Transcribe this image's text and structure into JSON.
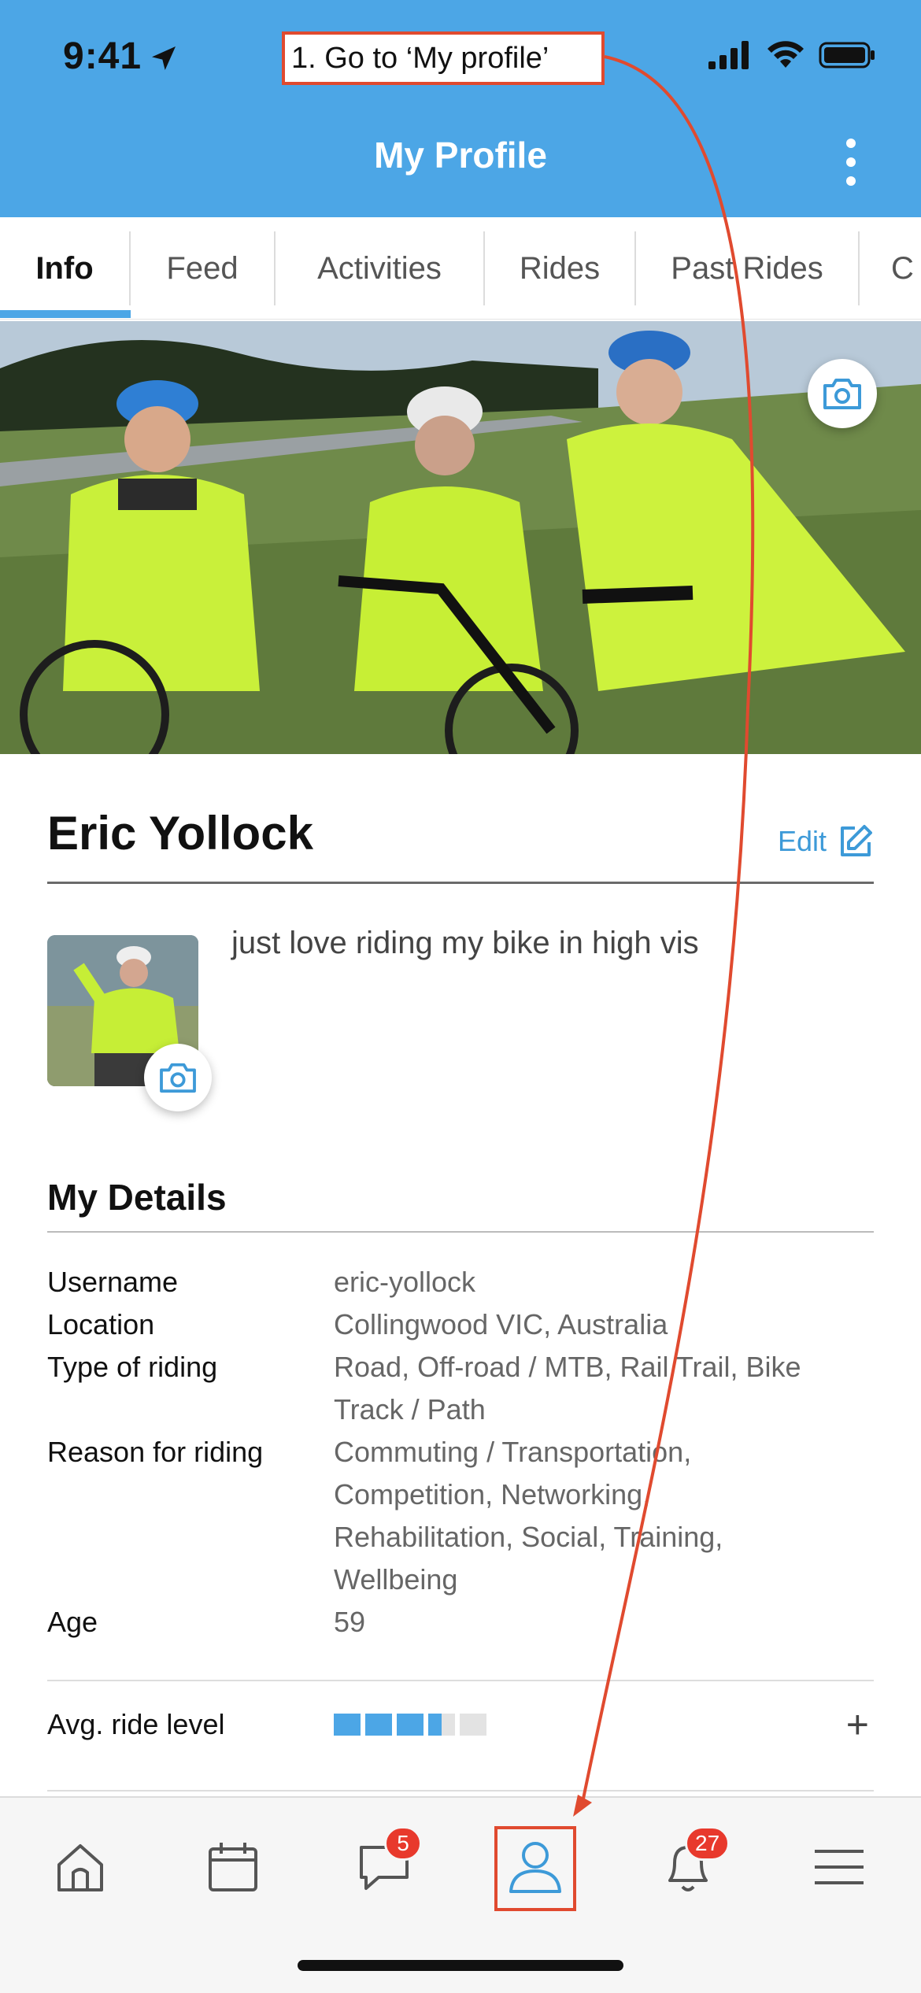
{
  "status_bar": {
    "time": "9:41"
  },
  "annotation": {
    "text": "1. Go to ‘My profile’",
    "color": "#e04a2f"
  },
  "header": {
    "title": "My Profile",
    "menu_icon": "kebab-menu-icon"
  },
  "tabs": [
    {
      "label": "Info",
      "active": true
    },
    {
      "label": "Feed",
      "active": false
    },
    {
      "label": "Activities",
      "active": false
    },
    {
      "label": "Rides",
      "active": false
    },
    {
      "label": "Past Rides",
      "active": false
    },
    {
      "label": "C",
      "active": false
    }
  ],
  "profile": {
    "name": "Eric Yollock",
    "edit_label": "Edit",
    "bio": "just love riding my bike in high vis"
  },
  "details": {
    "title": "My Details",
    "rows": [
      {
        "label": "Username",
        "value": "eric-yollock"
      },
      {
        "label": "Location",
        "value": "Collingwood VIC, Australia"
      },
      {
        "label": "Type of riding",
        "value": "Road, Off-road / MTB, Rail Trail, Bike Track / Path"
      },
      {
        "label": "Reason for riding",
        "value": "Commuting / Transportation, Competition, Networking, Rehabilitation, Social, Training, Wellbeing"
      },
      {
        "label": "Age",
        "value": "59"
      }
    ]
  },
  "ride_level": {
    "label": "Avg. ride level",
    "level": 3.5,
    "max": 5,
    "action": "+"
  },
  "bottom_nav": {
    "items": [
      {
        "name": "home",
        "icon": "home-icon"
      },
      {
        "name": "calendar",
        "icon": "calendar-icon"
      },
      {
        "name": "messages",
        "icon": "chat-icon",
        "badge": "5"
      },
      {
        "name": "profile",
        "icon": "user-icon",
        "active": true
      },
      {
        "name": "notifications",
        "icon": "bell-icon",
        "badge": "27"
      },
      {
        "name": "menu",
        "icon": "hamburger-icon"
      }
    ]
  },
  "colors": {
    "brand_blue": "#4ca6e6",
    "badge_red": "#e8392c"
  }
}
